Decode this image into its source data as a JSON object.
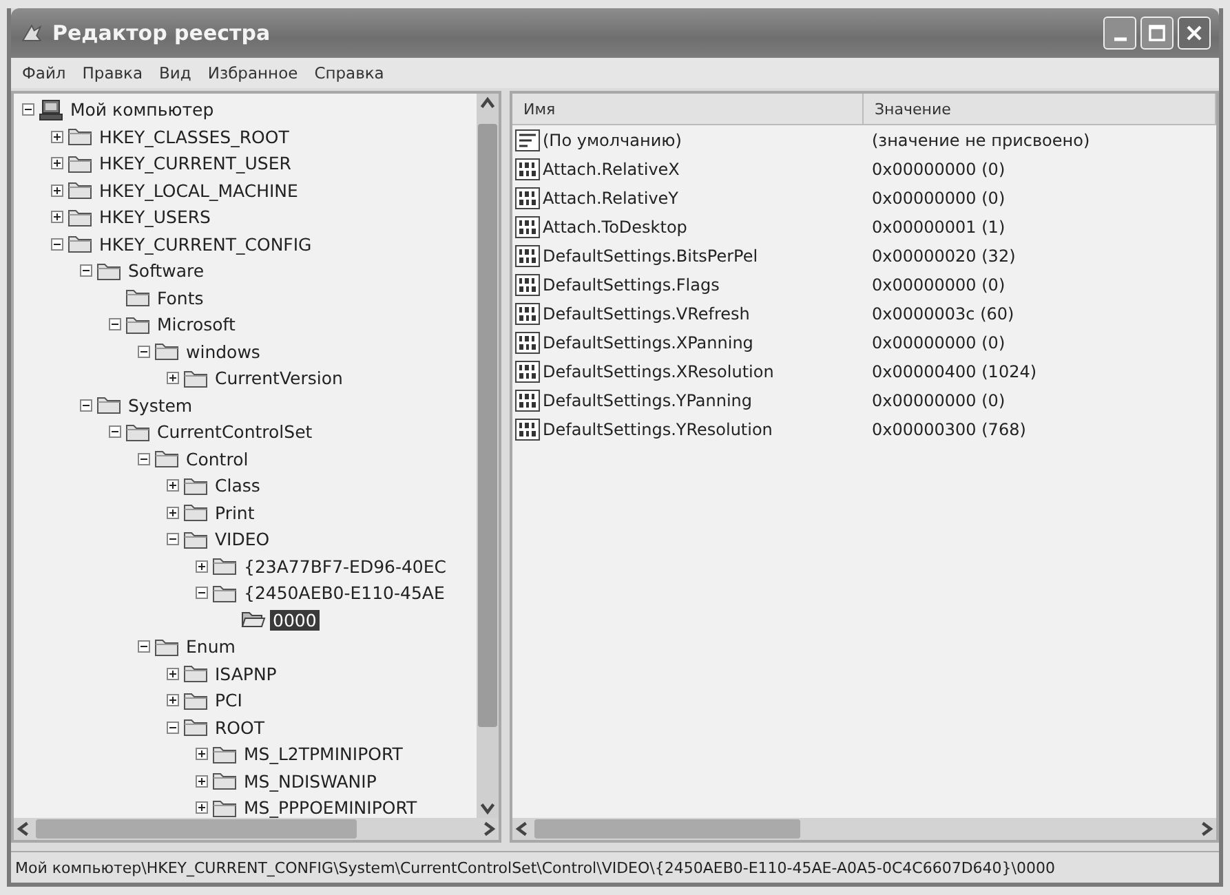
{
  "window": {
    "title": "Редактор реестра"
  },
  "menu": [
    "Файл",
    "Правка",
    "Вид",
    "Избранное",
    "Справка"
  ],
  "tree": [
    {
      "label": "Мой компьютер",
      "kind": "computer",
      "has_children": true,
      "expanded": true,
      "selected": false,
      "children": [
        {
          "label": "HKEY_CLASSES_ROOT",
          "kind": "folder",
          "has_children": true,
          "expanded": false,
          "selected": false
        },
        {
          "label": "HKEY_CURRENT_USER",
          "kind": "folder",
          "has_children": true,
          "expanded": false,
          "selected": false
        },
        {
          "label": "HKEY_LOCAL_MACHINE",
          "kind": "folder",
          "has_children": true,
          "expanded": false,
          "selected": false
        },
        {
          "label": "HKEY_USERS",
          "kind": "folder",
          "has_children": true,
          "expanded": false,
          "selected": false
        },
        {
          "label": "HKEY_CURRENT_CONFIG",
          "kind": "folder",
          "has_children": true,
          "expanded": true,
          "selected": false,
          "children": [
            {
              "label": "Software",
              "kind": "folder",
              "has_children": true,
              "expanded": true,
              "selected": false,
              "children": [
                {
                  "label": "Fonts",
                  "kind": "folder",
                  "has_children": false,
                  "expanded": false,
                  "selected": false
                },
                {
                  "label": "Microsoft",
                  "kind": "folder",
                  "has_children": true,
                  "expanded": true,
                  "selected": false,
                  "children": [
                    {
                      "label": "windows",
                      "kind": "folder",
                      "has_children": true,
                      "expanded": true,
                      "selected": false,
                      "children": [
                        {
                          "label": "CurrentVersion",
                          "kind": "folder",
                          "has_children": true,
                          "expanded": false,
                          "selected": false
                        }
                      ]
                    }
                  ]
                }
              ]
            },
            {
              "label": "System",
              "kind": "folder",
              "has_children": true,
              "expanded": true,
              "selected": false,
              "children": [
                {
                  "label": "CurrentControlSet",
                  "kind": "folder",
                  "has_children": true,
                  "expanded": true,
                  "selected": false,
                  "children": [
                    {
                      "label": "Control",
                      "kind": "folder",
                      "has_children": true,
                      "expanded": true,
                      "selected": false,
                      "children": [
                        {
                          "label": "Class",
                          "kind": "folder",
                          "has_children": true,
                          "expanded": false,
                          "selected": false
                        },
                        {
                          "label": "Print",
                          "kind": "folder",
                          "has_children": true,
                          "expanded": false,
                          "selected": false
                        },
                        {
                          "label": "VIDEO",
                          "kind": "folder",
                          "has_children": true,
                          "expanded": true,
                          "selected": false,
                          "children": [
                            {
                              "label": "{23A77BF7-ED96-40EC",
                              "kind": "folder",
                              "has_children": true,
                              "expanded": false,
                              "selected": false
                            },
                            {
                              "label": "{2450AEB0-E110-45AE",
                              "kind": "folder",
                              "has_children": true,
                              "expanded": true,
                              "selected": false,
                              "children": [
                                {
                                  "label": "0000",
                                  "kind": "folder",
                                  "has_children": false,
                                  "expanded": false,
                                  "selected": true
                                }
                              ]
                            }
                          ]
                        }
                      ]
                    },
                    {
                      "label": "Enum",
                      "kind": "folder",
                      "has_children": true,
                      "expanded": true,
                      "selected": false,
                      "children": [
                        {
                          "label": "ISAPNP",
                          "kind": "folder",
                          "has_children": true,
                          "expanded": false,
                          "selected": false
                        },
                        {
                          "label": "PCI",
                          "kind": "folder",
                          "has_children": true,
                          "expanded": false,
                          "selected": false
                        },
                        {
                          "label": "ROOT",
                          "kind": "folder",
                          "has_children": true,
                          "expanded": true,
                          "selected": false,
                          "children": [
                            {
                              "label": "MS_L2TPMINIPORT",
                              "kind": "folder",
                              "has_children": true,
                              "expanded": false,
                              "selected": false
                            },
                            {
                              "label": "MS_NDISWANIP",
                              "kind": "folder",
                              "has_children": true,
                              "expanded": false,
                              "selected": false
                            },
                            {
                              "label": "MS_PPPOEMINIPORT",
                              "kind": "folder",
                              "has_children": true,
                              "expanded": false,
                              "selected": false
                            }
                          ]
                        }
                      ]
                    }
                  ]
                }
              ]
            }
          ]
        }
      ]
    }
  ],
  "values": {
    "columns": [
      "Имя",
      "Значение"
    ],
    "rows": [
      {
        "kind": "string",
        "name": "(По умолчанию)",
        "value": "(значение не присвоено)"
      },
      {
        "kind": "dword",
        "name": "Attach.RelativeX",
        "value": "0x00000000 (0)"
      },
      {
        "kind": "dword",
        "name": "Attach.RelativeY",
        "value": "0x00000000 (0)"
      },
      {
        "kind": "dword",
        "name": "Attach.ToDesktop",
        "value": "0x00000001 (1)"
      },
      {
        "kind": "dword",
        "name": "DefaultSettings.BitsPerPel",
        "value": "0x00000020 (32)"
      },
      {
        "kind": "dword",
        "name": "DefaultSettings.Flags",
        "value": "0x00000000 (0)"
      },
      {
        "kind": "dword",
        "name": "DefaultSettings.VRefresh",
        "value": "0x0000003c (60)"
      },
      {
        "kind": "dword",
        "name": "DefaultSettings.XPanning",
        "value": "0x00000000 (0)"
      },
      {
        "kind": "dword",
        "name": "DefaultSettings.XResolution",
        "value": "0x00000400 (1024)"
      },
      {
        "kind": "dword",
        "name": "DefaultSettings.YPanning",
        "value": "0x00000000 (0)"
      },
      {
        "kind": "dword",
        "name": "DefaultSettings.YResolution",
        "value": "0x00000300 (768)"
      }
    ]
  },
  "status_bar": "Мой компьютер\\HKEY_CURRENT_CONFIG\\System\\CurrentControlSet\\Control\\VIDEO\\{2450AEB0-E110-45AE-A0A5-0C4C6607D640}\\0000"
}
